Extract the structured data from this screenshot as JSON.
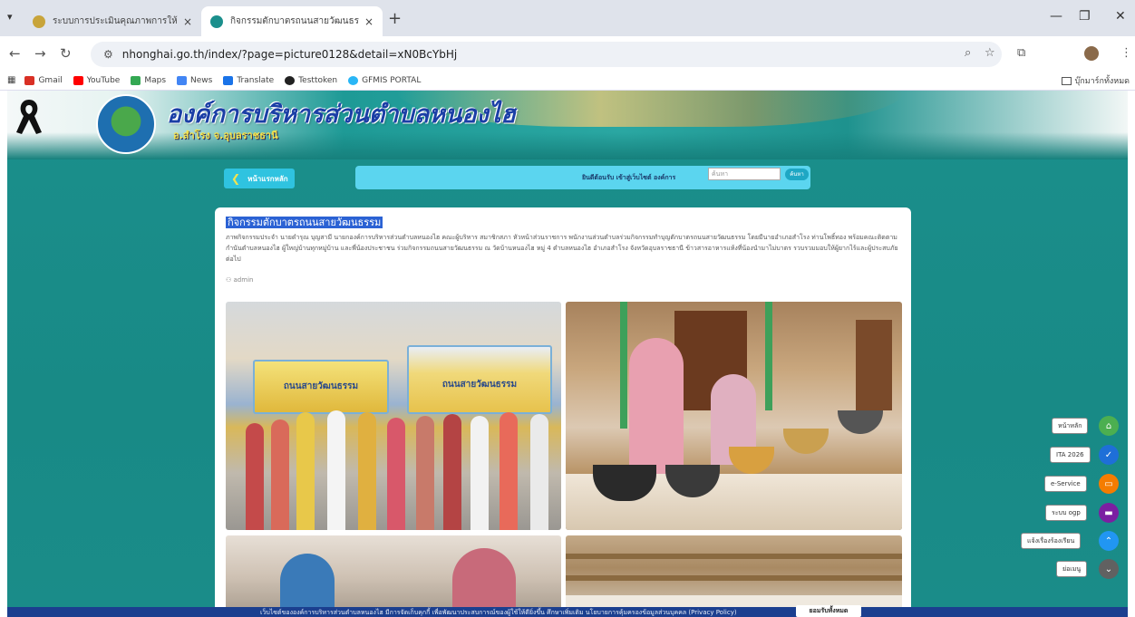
{
  "browser": {
    "tabs": [
      {
        "title": "ระบบการประเมินคุณภาพการให้บริการของ",
        "active": false
      },
      {
        "title": "กิจกรรมตักบาตรถนนสายวัฒนธรรม",
        "active": true
      }
    ],
    "close_glyph": "×",
    "new_tab_glyph": "+",
    "url": "nhonghai.go.th/index/?page=picture0128&detail=xN0BcYbHj",
    "bookmarks": [
      "Gmail",
      "YouTube",
      "Maps",
      "News",
      "Translate",
      "Testtoken",
      "GFMIS PORTAL"
    ],
    "bookmark_folder": "บุ๊กมาร์กทั้งหมด"
  },
  "site": {
    "title": "องค์การบริหารส่วนตำบลหนองไฮ",
    "subtitle": "อ.สำโรง จ.อุบลราชธานี",
    "nav": {
      "home_label": "หน้าแรกหลัก",
      "welcome_text": "ยินดีต้อนรับ เข้าสู่เว็บไซต์ องค์การ",
      "search_placeholder": "ค้นหา",
      "search_button": "ค้นหา"
    }
  },
  "post": {
    "title": "กิจกรรมตักบาตรถนนสายวัฒนธรรม",
    "body": "ภาพกิจกรรมประจำ นายดำรุณ บุญสามี นายกองค์การบริหารส่วนตำบลหนองไฮ คณะผู้บริหาร สมาชิกสภา หัวหน้าส่วนราชการ พนักงานส่วนตำบลร่วมกิจกรรมทำบุญตักบาตรถนนสายวัฒนธรรม โดยมีนายอำเภอสำโรง ท่านโพธิ์ทอง พร้อมคณะติดตาม กำนันตำบลหนองไฮ ผู้ใหญ่บ้านทุกหมู่บ้าน และพี่น้องประชาชน ร่วมกิจกรรมถนนสายวัฒนธรรม ณ วัดบ้านหนองไฮ หมู่ 4 ตำบลหนองไฮ อำเภอสำโรง จังหวัดอุบลราชธานี ข้าวสารอาหารแห้งที่น้องนำมาไม่บาตร รวบรวมมอบให้ผู้ยากไร้และผู้ประสบภัยต่อไป",
    "author": "admin",
    "photo_text": {
      "banner_left": "ถนนสายวัฒนธรรม",
      "banner_right": "ถนนสายวัฒนธรรม"
    }
  },
  "floating_menu": [
    {
      "label": "หน้าหลัก",
      "icon": "home-icon",
      "color": "#4caf50",
      "glyph": "⌂"
    },
    {
      "label": "ITA 2026",
      "icon": "check-badge-icon",
      "color": "#1e6fd8",
      "glyph": "✓"
    },
    {
      "label": "e-Service",
      "icon": "chat-icon",
      "color": "#f57c00",
      "glyph": "▭"
    },
    {
      "label": "ระบบ ogp",
      "icon": "message-icon",
      "color": "#7b1fa2",
      "glyph": "▬"
    },
    {
      "label": "แจ้งเรื่องร้องเรียน",
      "icon": "arrow-up-icon",
      "color": "#2196f3",
      "glyph": "⌃"
    },
    {
      "label": "ย่อเมนู",
      "icon": "chevron-down-icon",
      "color": "#616161",
      "glyph": "⌄"
    }
  ],
  "cookie": {
    "text": "เว็บไซต์ขององค์การบริหารส่วนตำบลหนองไฮ มีการจัดเก็บคุกกี้ เพื่อพัฒนาประสบการณ์ของผู้ใช้ให้ดียิ่งขึ้น ศึกษาเพิ่มเติม นโยบายการคุ้มครองข้อมูลส่วนบุคคล (Privacy Policy)",
    "accept": "ยอมรับทั้งหมด"
  }
}
